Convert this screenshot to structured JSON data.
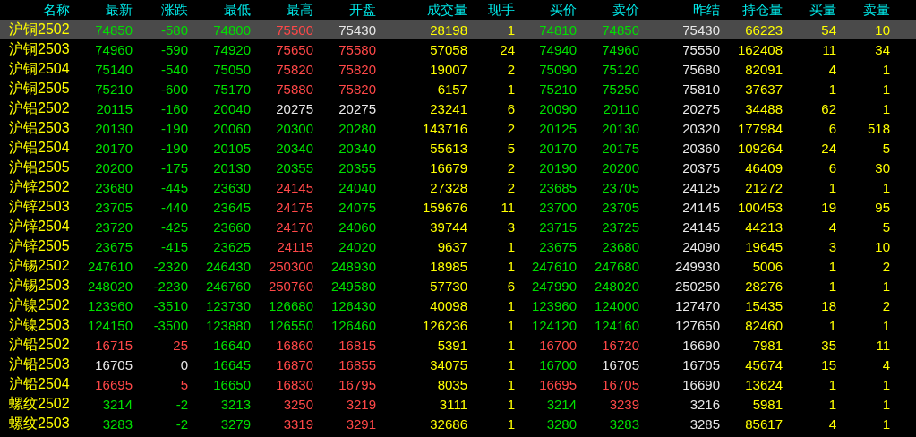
{
  "columns": [
    {
      "label": "名称",
      "kind": "name"
    },
    {
      "label": "最新",
      "kind": "price"
    },
    {
      "label": "涨跌",
      "kind": "price"
    },
    {
      "label": "最低",
      "kind": "price"
    },
    {
      "label": "最高",
      "kind": "price"
    },
    {
      "label": "开盘",
      "kind": "price"
    },
    {
      "label": "成交量",
      "kind": "volume"
    },
    {
      "label": "现手",
      "kind": "volume"
    },
    {
      "label": "买价",
      "kind": "price"
    },
    {
      "label": "卖价",
      "kind": "price"
    },
    {
      "label": "昨结",
      "kind": "settle"
    },
    {
      "label": "持仓量",
      "kind": "volume"
    },
    {
      "label": "买量",
      "kind": "volume"
    },
    {
      "label": "卖量",
      "kind": "volume"
    }
  ],
  "rows": [
    {
      "selected": true,
      "cells": [
        {
          "text": "沪铜2502"
        },
        {
          "text": "74850",
          "color": "#00e000"
        },
        {
          "text": "-580",
          "color": "#00e000"
        },
        {
          "text": "74800",
          "color": "#00e000"
        },
        {
          "text": "75500",
          "color": "#ff4848"
        },
        {
          "text": "75430",
          "color": "#e8e8e8"
        },
        {
          "text": "28198"
        },
        {
          "text": "1"
        },
        {
          "text": "74810",
          "color": "#00e000"
        },
        {
          "text": "74850",
          "color": "#00e000"
        },
        {
          "text": "75430"
        },
        {
          "text": "66223"
        },
        {
          "text": "54"
        },
        {
          "text": "10"
        }
      ]
    },
    {
      "selected": false,
      "cells": [
        {
          "text": "沪铜2503"
        },
        {
          "text": "74960",
          "color": "#00e000"
        },
        {
          "text": "-590",
          "color": "#00e000"
        },
        {
          "text": "74920",
          "color": "#00e000"
        },
        {
          "text": "75650",
          "color": "#ff4848"
        },
        {
          "text": "75580",
          "color": "#ff4848"
        },
        {
          "text": "57058"
        },
        {
          "text": "24"
        },
        {
          "text": "74940",
          "color": "#00e000"
        },
        {
          "text": "74960",
          "color": "#00e000"
        },
        {
          "text": "75550"
        },
        {
          "text": "162408"
        },
        {
          "text": "11"
        },
        {
          "text": "34"
        }
      ]
    },
    {
      "selected": false,
      "cells": [
        {
          "text": "沪铜2504"
        },
        {
          "text": "75140",
          "color": "#00e000"
        },
        {
          "text": "-540",
          "color": "#00e000"
        },
        {
          "text": "75050",
          "color": "#00e000"
        },
        {
          "text": "75820",
          "color": "#ff4848"
        },
        {
          "text": "75820",
          "color": "#ff4848"
        },
        {
          "text": "19007"
        },
        {
          "text": "2"
        },
        {
          "text": "75090",
          "color": "#00e000"
        },
        {
          "text": "75120",
          "color": "#00e000"
        },
        {
          "text": "75680"
        },
        {
          "text": "82091"
        },
        {
          "text": "4"
        },
        {
          "text": "1"
        }
      ]
    },
    {
      "selected": false,
      "cells": [
        {
          "text": "沪铜2505"
        },
        {
          "text": "75210",
          "color": "#00e000"
        },
        {
          "text": "-600",
          "color": "#00e000"
        },
        {
          "text": "75170",
          "color": "#00e000"
        },
        {
          "text": "75880",
          "color": "#ff4848"
        },
        {
          "text": "75820",
          "color": "#ff4848"
        },
        {
          "text": "6157"
        },
        {
          "text": "1"
        },
        {
          "text": "75210",
          "color": "#00e000"
        },
        {
          "text": "75250",
          "color": "#00e000"
        },
        {
          "text": "75810"
        },
        {
          "text": "37637"
        },
        {
          "text": "1"
        },
        {
          "text": "1"
        }
      ]
    },
    {
      "selected": false,
      "cells": [
        {
          "text": "沪铝2502"
        },
        {
          "text": "20115",
          "color": "#00e000"
        },
        {
          "text": "-160",
          "color": "#00e000"
        },
        {
          "text": "20040",
          "color": "#00e000"
        },
        {
          "text": "20275",
          "color": "#e8e8e8"
        },
        {
          "text": "20275",
          "color": "#e8e8e8"
        },
        {
          "text": "23241"
        },
        {
          "text": "6"
        },
        {
          "text": "20090",
          "color": "#00e000"
        },
        {
          "text": "20110",
          "color": "#00e000"
        },
        {
          "text": "20275"
        },
        {
          "text": "34488"
        },
        {
          "text": "62"
        },
        {
          "text": "1"
        }
      ]
    },
    {
      "selected": false,
      "cells": [
        {
          "text": "沪铝2503"
        },
        {
          "text": "20130",
          "color": "#00e000"
        },
        {
          "text": "-190",
          "color": "#00e000"
        },
        {
          "text": "20060",
          "color": "#00e000"
        },
        {
          "text": "20300",
          "color": "#00e000"
        },
        {
          "text": "20280",
          "color": "#00e000"
        },
        {
          "text": "143716"
        },
        {
          "text": "2"
        },
        {
          "text": "20125",
          "color": "#00e000"
        },
        {
          "text": "20130",
          "color": "#00e000"
        },
        {
          "text": "20320"
        },
        {
          "text": "177984"
        },
        {
          "text": "6"
        },
        {
          "text": "518"
        }
      ]
    },
    {
      "selected": false,
      "cells": [
        {
          "text": "沪铝2504"
        },
        {
          "text": "20170",
          "color": "#00e000"
        },
        {
          "text": "-190",
          "color": "#00e000"
        },
        {
          "text": "20105",
          "color": "#00e000"
        },
        {
          "text": "20340",
          "color": "#00e000"
        },
        {
          "text": "20340",
          "color": "#00e000"
        },
        {
          "text": "55613"
        },
        {
          "text": "5"
        },
        {
          "text": "20170",
          "color": "#00e000"
        },
        {
          "text": "20175",
          "color": "#00e000"
        },
        {
          "text": "20360"
        },
        {
          "text": "109264"
        },
        {
          "text": "24"
        },
        {
          "text": "5"
        }
      ]
    },
    {
      "selected": false,
      "cells": [
        {
          "text": "沪铝2505"
        },
        {
          "text": "20200",
          "color": "#00e000"
        },
        {
          "text": "-175",
          "color": "#00e000"
        },
        {
          "text": "20130",
          "color": "#00e000"
        },
        {
          "text": "20355",
          "color": "#00e000"
        },
        {
          "text": "20355",
          "color": "#00e000"
        },
        {
          "text": "16679"
        },
        {
          "text": "2"
        },
        {
          "text": "20190",
          "color": "#00e000"
        },
        {
          "text": "20200",
          "color": "#00e000"
        },
        {
          "text": "20375"
        },
        {
          "text": "46409"
        },
        {
          "text": "6"
        },
        {
          "text": "30"
        }
      ]
    },
    {
      "selected": false,
      "cells": [
        {
          "text": "沪锌2502"
        },
        {
          "text": "23680",
          "color": "#00e000"
        },
        {
          "text": "-445",
          "color": "#00e000"
        },
        {
          "text": "23630",
          "color": "#00e000"
        },
        {
          "text": "24145",
          "color": "#ff4848"
        },
        {
          "text": "24040",
          "color": "#00e000"
        },
        {
          "text": "27328"
        },
        {
          "text": "2"
        },
        {
          "text": "23685",
          "color": "#00e000"
        },
        {
          "text": "23705",
          "color": "#00e000"
        },
        {
          "text": "24125"
        },
        {
          "text": "21272"
        },
        {
          "text": "1"
        },
        {
          "text": "1"
        }
      ]
    },
    {
      "selected": false,
      "cells": [
        {
          "text": "沪锌2503"
        },
        {
          "text": "23705",
          "color": "#00e000"
        },
        {
          "text": "-440",
          "color": "#00e000"
        },
        {
          "text": "23645",
          "color": "#00e000"
        },
        {
          "text": "24175",
          "color": "#ff4848"
        },
        {
          "text": "24075",
          "color": "#00e000"
        },
        {
          "text": "159676"
        },
        {
          "text": "11"
        },
        {
          "text": "23700",
          "color": "#00e000"
        },
        {
          "text": "23705",
          "color": "#00e000"
        },
        {
          "text": "24145"
        },
        {
          "text": "100453"
        },
        {
          "text": "19"
        },
        {
          "text": "95"
        }
      ]
    },
    {
      "selected": false,
      "cells": [
        {
          "text": "沪锌2504"
        },
        {
          "text": "23720",
          "color": "#00e000"
        },
        {
          "text": "-425",
          "color": "#00e000"
        },
        {
          "text": "23660",
          "color": "#00e000"
        },
        {
          "text": "24170",
          "color": "#ff4848"
        },
        {
          "text": "24060",
          "color": "#00e000"
        },
        {
          "text": "39744"
        },
        {
          "text": "3"
        },
        {
          "text": "23715",
          "color": "#00e000"
        },
        {
          "text": "23725",
          "color": "#00e000"
        },
        {
          "text": "24145"
        },
        {
          "text": "44213"
        },
        {
          "text": "4"
        },
        {
          "text": "5"
        }
      ]
    },
    {
      "selected": false,
      "cells": [
        {
          "text": "沪锌2505"
        },
        {
          "text": "23675",
          "color": "#00e000"
        },
        {
          "text": "-415",
          "color": "#00e000"
        },
        {
          "text": "23625",
          "color": "#00e000"
        },
        {
          "text": "24115",
          "color": "#ff4848"
        },
        {
          "text": "24020",
          "color": "#00e000"
        },
        {
          "text": "9637"
        },
        {
          "text": "1"
        },
        {
          "text": "23675",
          "color": "#00e000"
        },
        {
          "text": "23680",
          "color": "#00e000"
        },
        {
          "text": "24090"
        },
        {
          "text": "19645"
        },
        {
          "text": "3"
        },
        {
          "text": "10"
        }
      ]
    },
    {
      "selected": false,
      "cells": [
        {
          "text": "沪锡2502"
        },
        {
          "text": "247610",
          "color": "#00e000"
        },
        {
          "text": "-2320",
          "color": "#00e000"
        },
        {
          "text": "246430",
          "color": "#00e000"
        },
        {
          "text": "250300",
          "color": "#ff4848"
        },
        {
          "text": "248930",
          "color": "#00e000"
        },
        {
          "text": "18985"
        },
        {
          "text": "1"
        },
        {
          "text": "247610",
          "color": "#00e000"
        },
        {
          "text": "247680",
          "color": "#00e000"
        },
        {
          "text": "249930"
        },
        {
          "text": "5006"
        },
        {
          "text": "1"
        },
        {
          "text": "2"
        }
      ]
    },
    {
      "selected": false,
      "cells": [
        {
          "text": "沪锡2503"
        },
        {
          "text": "248020",
          "color": "#00e000"
        },
        {
          "text": "-2230",
          "color": "#00e000"
        },
        {
          "text": "246760",
          "color": "#00e000"
        },
        {
          "text": "250760",
          "color": "#ff4848"
        },
        {
          "text": "249580",
          "color": "#00e000"
        },
        {
          "text": "57730"
        },
        {
          "text": "6"
        },
        {
          "text": "247990",
          "color": "#00e000"
        },
        {
          "text": "248020",
          "color": "#00e000"
        },
        {
          "text": "250250"
        },
        {
          "text": "28276"
        },
        {
          "text": "1"
        },
        {
          "text": "1"
        }
      ]
    },
    {
      "selected": false,
      "cells": [
        {
          "text": "沪镍2502"
        },
        {
          "text": "123960",
          "color": "#00e000"
        },
        {
          "text": "-3510",
          "color": "#00e000"
        },
        {
          "text": "123730",
          "color": "#00e000"
        },
        {
          "text": "126680",
          "color": "#00e000"
        },
        {
          "text": "126430",
          "color": "#00e000"
        },
        {
          "text": "40098"
        },
        {
          "text": "1"
        },
        {
          "text": "123960",
          "color": "#00e000"
        },
        {
          "text": "124000",
          "color": "#00e000"
        },
        {
          "text": "127470"
        },
        {
          "text": "15435"
        },
        {
          "text": "18"
        },
        {
          "text": "2"
        }
      ]
    },
    {
      "selected": false,
      "cells": [
        {
          "text": "沪镍2503"
        },
        {
          "text": "124150",
          "color": "#00e000"
        },
        {
          "text": "-3500",
          "color": "#00e000"
        },
        {
          "text": "123880",
          "color": "#00e000"
        },
        {
          "text": "126550",
          "color": "#00e000"
        },
        {
          "text": "126460",
          "color": "#00e000"
        },
        {
          "text": "126236"
        },
        {
          "text": "1"
        },
        {
          "text": "124120",
          "color": "#00e000"
        },
        {
          "text": "124160",
          "color": "#00e000"
        },
        {
          "text": "127650"
        },
        {
          "text": "82460"
        },
        {
          "text": "1"
        },
        {
          "text": "1"
        }
      ]
    },
    {
      "selected": false,
      "cells": [
        {
          "text": "沪铅2502"
        },
        {
          "text": "16715",
          "color": "#ff4848"
        },
        {
          "text": "25",
          "color": "#ff4848"
        },
        {
          "text": "16640",
          "color": "#00e000"
        },
        {
          "text": "16860",
          "color": "#ff4848"
        },
        {
          "text": "16815",
          "color": "#ff4848"
        },
        {
          "text": "5391"
        },
        {
          "text": "1"
        },
        {
          "text": "16700",
          "color": "#ff4848"
        },
        {
          "text": "16720",
          "color": "#ff4848"
        },
        {
          "text": "16690"
        },
        {
          "text": "7981"
        },
        {
          "text": "35"
        },
        {
          "text": "11"
        }
      ]
    },
    {
      "selected": false,
      "cells": [
        {
          "text": "沪铅2503"
        },
        {
          "text": "16705",
          "color": "#e8e8e8"
        },
        {
          "text": "0",
          "color": "#e8e8e8"
        },
        {
          "text": "16645",
          "color": "#00e000"
        },
        {
          "text": "16870",
          "color": "#ff4848"
        },
        {
          "text": "16855",
          "color": "#ff4848"
        },
        {
          "text": "34075"
        },
        {
          "text": "1"
        },
        {
          "text": "16700",
          "color": "#00e000"
        },
        {
          "text": "16705",
          "color": "#e8e8e8"
        },
        {
          "text": "16705"
        },
        {
          "text": "45674"
        },
        {
          "text": "15"
        },
        {
          "text": "4"
        }
      ]
    },
    {
      "selected": false,
      "cells": [
        {
          "text": "沪铅2504"
        },
        {
          "text": "16695",
          "color": "#ff4848"
        },
        {
          "text": "5",
          "color": "#ff4848"
        },
        {
          "text": "16650",
          "color": "#00e000"
        },
        {
          "text": "16830",
          "color": "#ff4848"
        },
        {
          "text": "16795",
          "color": "#ff4848"
        },
        {
          "text": "8035"
        },
        {
          "text": "1"
        },
        {
          "text": "16695",
          "color": "#ff4848"
        },
        {
          "text": "16705",
          "color": "#ff4848"
        },
        {
          "text": "16690"
        },
        {
          "text": "13624"
        },
        {
          "text": "1"
        },
        {
          "text": "1"
        }
      ]
    },
    {
      "selected": false,
      "cells": [
        {
          "text": "螺纹2502"
        },
        {
          "text": "3214",
          "color": "#00e000"
        },
        {
          "text": "-2",
          "color": "#00e000"
        },
        {
          "text": "3213",
          "color": "#00e000"
        },
        {
          "text": "3250",
          "color": "#ff4848"
        },
        {
          "text": "3219",
          "color": "#ff4848"
        },
        {
          "text": "3111"
        },
        {
          "text": "1"
        },
        {
          "text": "3214",
          "color": "#00e000"
        },
        {
          "text": "3239",
          "color": "#ff4848"
        },
        {
          "text": "3216"
        },
        {
          "text": "5981"
        },
        {
          "text": "1"
        },
        {
          "text": "1"
        }
      ]
    },
    {
      "selected": false,
      "cells": [
        {
          "text": "螺纹2503"
        },
        {
          "text": "3283",
          "color": "#00e000"
        },
        {
          "text": "-2",
          "color": "#00e000"
        },
        {
          "text": "3279",
          "color": "#00e000"
        },
        {
          "text": "3319",
          "color": "#ff4848"
        },
        {
          "text": "3291",
          "color": "#ff4848"
        },
        {
          "text": "32686"
        },
        {
          "text": "1"
        },
        {
          "text": "3280",
          "color": "#00e000"
        },
        {
          "text": "3283",
          "color": "#00e000"
        },
        {
          "text": "3285"
        },
        {
          "text": "85617"
        },
        {
          "text": "4"
        },
        {
          "text": "1"
        }
      ]
    }
  ]
}
